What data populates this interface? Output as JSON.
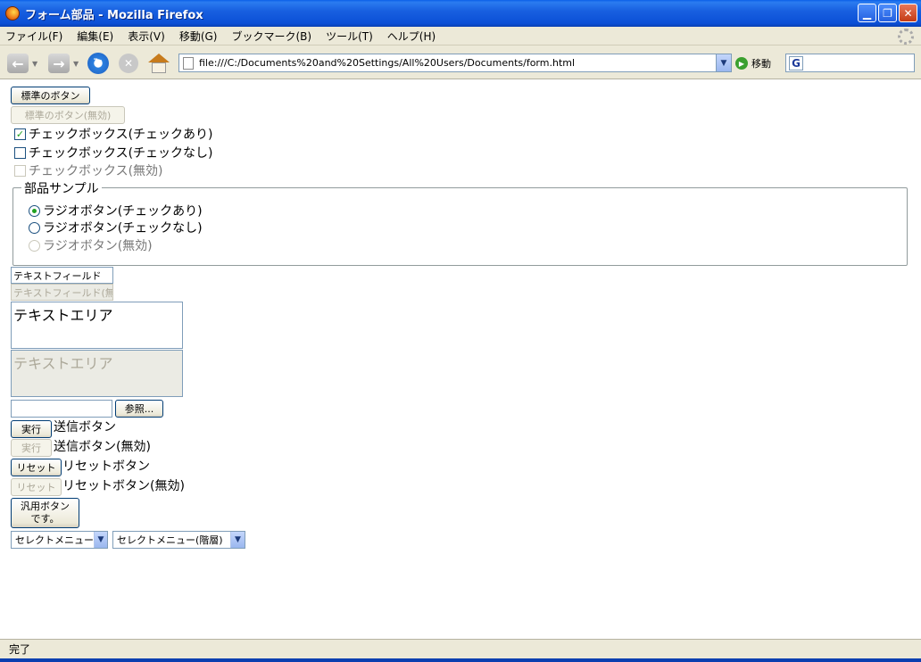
{
  "window": {
    "title": "フォーム部品 - Mozilla Firefox",
    "minimize": "▁",
    "maximize": "❐",
    "close": "✕"
  },
  "menu": [
    "ファイル(F)",
    "編集(E)",
    "表示(V)",
    "移動(G)",
    "ブックマーク(B)",
    "ツール(T)",
    "ヘルプ(H)"
  ],
  "nav": {
    "back": "←",
    "forward": "→",
    "reload": "↻",
    "stop": "✕",
    "url": "file:///C:/Documents%20and%20Settings/All%20Users/Documents/form.html",
    "url_drop": "▼",
    "go_label": "移動",
    "go_glyph": "▶",
    "search_engine": "G"
  },
  "form": {
    "std_button": "標準のボタン",
    "std_button_disabled": "標準のボタン(無効)",
    "check_on": "チェックボックス(チェックあり)",
    "check_on_mark": "✓",
    "check_off": "チェックボックス(チェックなし)",
    "check_disabled": "チェックボックス(無効)",
    "fieldset_legend": "部品サンプル",
    "radio_on": "ラジオボタン(チェックあり)",
    "radio_off": "ラジオボタン(チェックなし)",
    "radio_disabled": "ラジオボタン(無効)",
    "textfield": "テキストフィールド",
    "textfield_disabled": "テキストフィールド(無効)",
    "textarea": "テキストエリア",
    "textarea_disabled": "テキストエリア",
    "file_input": "",
    "browse_button": "参照...",
    "submit_button": "実行",
    "submit_label": "送信ボタン",
    "submit_button_disabled": "実行",
    "submit_label_disabled": "送信ボタン(無効)",
    "reset_button": "リセット",
    "reset_label": "リセットボタン",
    "reset_button_disabled": "リセット",
    "reset_label_disabled": "リセットボタン(無効)",
    "generic_button_line1": "汎用ボタン",
    "generic_button_line2": "です。",
    "select1": "セレクトメニュー",
    "select2": "セレクトメニュー(階層)",
    "select_arrow": "▼"
  },
  "status": {
    "text": "完了"
  }
}
